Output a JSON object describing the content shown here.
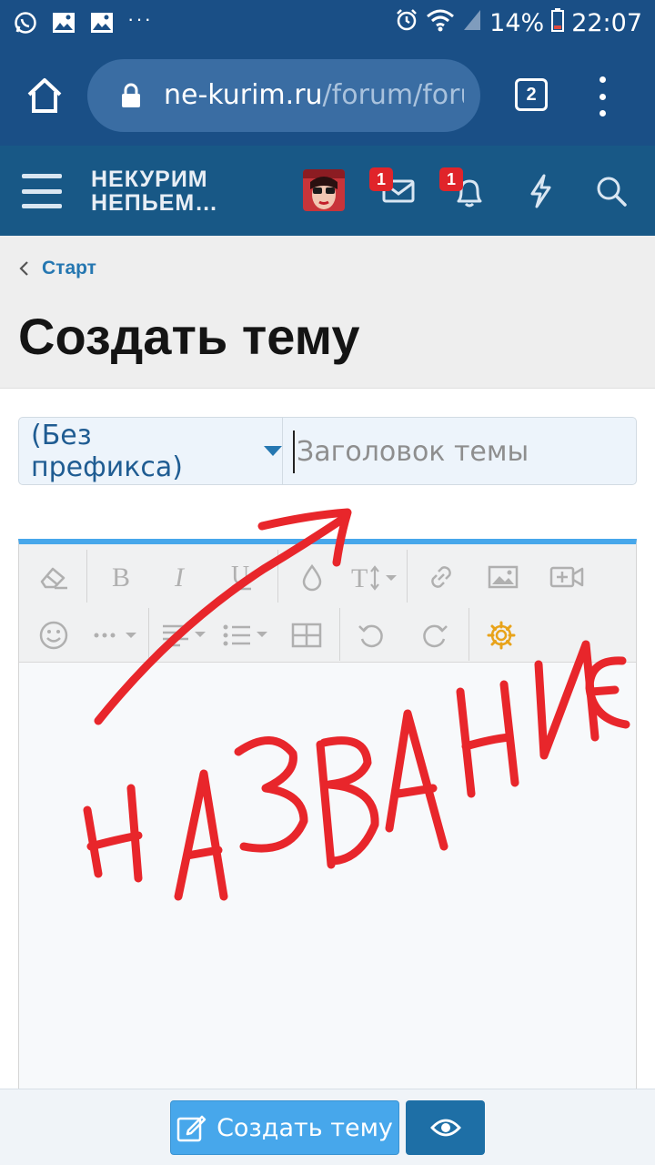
{
  "status_bar": {
    "battery": "14%",
    "time": "22:07",
    "icons": [
      "whatsapp-icon",
      "image-icon",
      "gallery-icon",
      "more-dots-icon",
      "alarm-icon",
      "wifi-icon",
      "signal-icon",
      "battery-icon"
    ]
  },
  "browser": {
    "url_host": "ne-kurim.ru",
    "url_path": "/forum/foru",
    "tab_count": "2"
  },
  "site": {
    "logo_line1": "НЕКУРИМ",
    "logo_line2": "НЕПЬЕМ…",
    "messages_badge": "1",
    "alerts_badge": "1"
  },
  "page": {
    "breadcrumb": "Старт",
    "title": "Создать тему"
  },
  "form": {
    "prefix_selected": "(Без префикса)",
    "title_placeholder": "Заголовок темы"
  },
  "editor": {
    "tools": [
      "eraser-icon",
      "bold-icon",
      "italic-icon",
      "underline-icon",
      "text-color-icon",
      "font-size-icon",
      "link-icon",
      "image-icon",
      "video-icon",
      "smiley-icon",
      "more-icon",
      "align-icon",
      "list-icon",
      "table-icon",
      "undo-icon",
      "redo-icon",
      "gear-icon"
    ],
    "accent_color": "#47a7eb"
  },
  "actions": {
    "submit_label": "Создать тему"
  },
  "colors": {
    "status_bar": "#1a4f86",
    "site_header": "#185886",
    "handwriting": "#e8262b"
  }
}
